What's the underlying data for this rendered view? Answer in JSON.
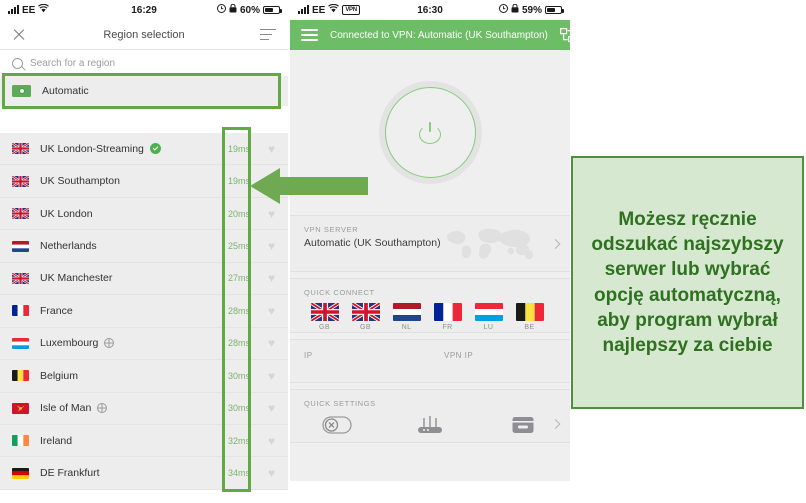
{
  "left_phone": {
    "status_bar": {
      "carrier": "EE",
      "wifi_icon": "wifi-icon",
      "time": "16:29",
      "alarm_icon": "alarm-icon",
      "rotation_lock_icon": "rotation-lock-icon",
      "battery_percent": "60%"
    },
    "navbar": {
      "close_icon": "close-icon",
      "title": "Region selection",
      "sort_icon": "sort-list-icon"
    },
    "search": {
      "icon": "search-icon",
      "placeholder": "Search for a region"
    },
    "automatic_row": {
      "label": "Automatic",
      "badge_icon": "auto-server-icon",
      "highlighted": true,
      "highlight_color": "#62a844"
    },
    "highlight_column": {
      "name": "latency-column-highlight",
      "color": "#62a844"
    },
    "regions": [
      {
        "name": "UK London-Streaming",
        "flag": "gb",
        "latency": "19ms",
        "selected": true,
        "virtual": false,
        "favorite_icon": "heart-icon"
      },
      {
        "name": "UK Southampton",
        "flag": "gb",
        "latency": "19ms",
        "selected": false,
        "virtual": false,
        "favorite_icon": "heart-icon"
      },
      {
        "name": "UK London",
        "flag": "gb",
        "latency": "20ms",
        "selected": false,
        "virtual": false,
        "favorite_icon": "heart-icon"
      },
      {
        "name": "Netherlands",
        "flag": "nl",
        "latency": "25ms",
        "selected": false,
        "virtual": false,
        "favorite_icon": "heart-icon"
      },
      {
        "name": "UK Manchester",
        "flag": "gb",
        "latency": "27ms",
        "selected": false,
        "virtual": false,
        "favorite_icon": "heart-icon"
      },
      {
        "name": "France",
        "flag": "fr",
        "latency": "28ms",
        "selected": false,
        "virtual": false,
        "favorite_icon": "heart-icon"
      },
      {
        "name": "Luxembourg",
        "flag": "lu",
        "latency": "28ms",
        "selected": false,
        "virtual": true,
        "favorite_icon": "heart-icon"
      },
      {
        "name": "Belgium",
        "flag": "be",
        "latency": "30ms",
        "selected": false,
        "virtual": false,
        "favorite_icon": "heart-icon"
      },
      {
        "name": "Isle of Man",
        "flag": "im",
        "latency": "30ms",
        "selected": false,
        "virtual": true,
        "favorite_icon": "heart-icon"
      },
      {
        "name": "Ireland",
        "flag": "ie",
        "latency": "32ms",
        "selected": false,
        "virtual": false,
        "favorite_icon": "heart-icon"
      },
      {
        "name": "DE Frankfurt",
        "flag": "de",
        "latency": "34ms",
        "selected": false,
        "virtual": false,
        "favorite_icon": "heart-icon"
      }
    ]
  },
  "annotation_arrow": {
    "name": "pointer-arrow",
    "direction": "left",
    "color": "#6faa52"
  },
  "right_phone": {
    "status_bar": {
      "carrier": "EE",
      "wifi_icon": "wifi-icon",
      "vpn_badge": "VPN",
      "time": "16:30",
      "alarm_icon": "alarm-icon",
      "rotation_lock_icon": "rotation-lock-icon",
      "battery_percent": "59%"
    },
    "header": {
      "menu_icon": "hamburger-menu-icon",
      "title": "Connected to VPN: Automatic (UK Southampton)",
      "right_icon": "network-toggle-icon",
      "background": "#6cbd65"
    },
    "power_button": {
      "name": "vpn-power-toggle",
      "icon": "power-icon",
      "state": "on",
      "color": "#84cc7c"
    },
    "vpn_server": {
      "label": "VPN SERVER",
      "value": "Automatic (UK Southampton)",
      "map_icon": "world-map-icon",
      "chevron_icon": "chevron-right-icon"
    },
    "quick_connect": {
      "label": "QUICK CONNECT",
      "items": [
        {
          "code": "GB",
          "flag": "gb"
        },
        {
          "code": "GB",
          "flag": "gb"
        },
        {
          "code": "NL",
          "flag": "nl"
        },
        {
          "code": "FR",
          "flag": "fr"
        },
        {
          "code": "LU",
          "flag": "lu"
        },
        {
          "code": "BE",
          "flag": "be"
        }
      ]
    },
    "ip_section": {
      "ip_label": "IP",
      "ip_value": "",
      "vpn_ip_label": "VPN IP",
      "vpn_ip_value": ""
    },
    "quick_settings": {
      "label": "QUICK SETTINGS",
      "items": [
        {
          "icon": "kill-switch-icon"
        },
        {
          "icon": "router-icon"
        },
        {
          "icon": "card-icon"
        }
      ],
      "chevron_icon": "chevron-right-icon"
    }
  },
  "callout": {
    "text": "Możesz ręcznie odszukać najszybszy serwer lub wybrać opcję automatyczną, aby program wybrał najlepszy za ciebie",
    "background": "#d6e8cf",
    "border_color": "#4f8f3e",
    "text_color": "#2f7021"
  }
}
